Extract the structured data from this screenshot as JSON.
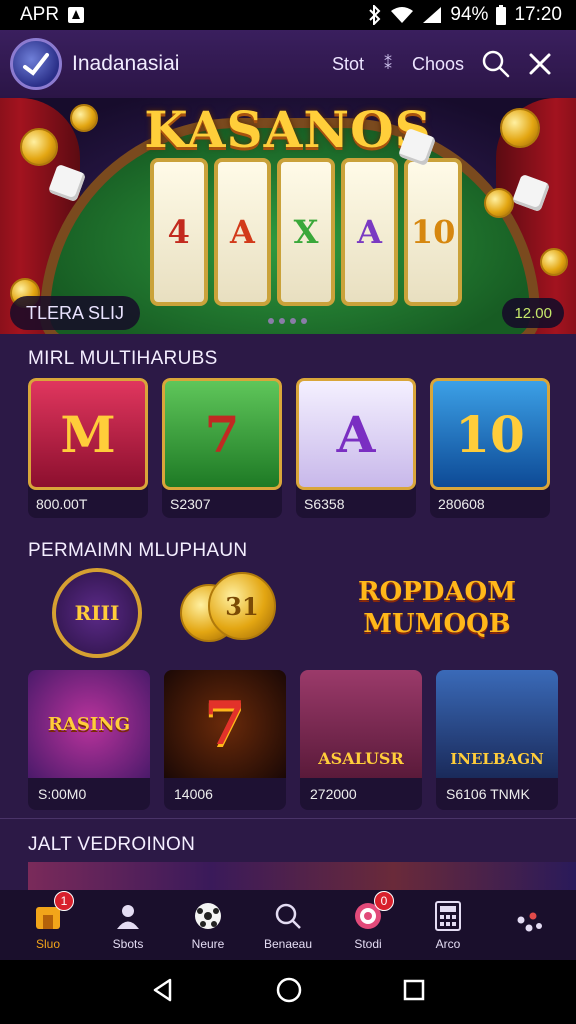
{
  "status": {
    "carrier": "APR",
    "battery_text": "94%",
    "time": "17:20"
  },
  "header": {
    "title": "Inadanasiai",
    "nav": [
      "Stot",
      "Choos"
    ],
    "dots": "⁑"
  },
  "hero": {
    "title": "KASANOS",
    "caption": "TLERA SLIJ",
    "badge": "12.00",
    "reel_symbols": [
      "4",
      "A",
      "X",
      "A",
      "10"
    ]
  },
  "sections": [
    {
      "title": "MIRL MULTIHARUBS",
      "cards": [
        {
          "symbol": "M",
          "label": "800.00T",
          "color": "#b8132a"
        },
        {
          "symbol": "7",
          "label": "S2307",
          "color": "#2f8f2f"
        },
        {
          "symbol": "A",
          "label": "S6358",
          "color": "#6b2ba8"
        },
        {
          "symbol": "10",
          "label": "280608",
          "color": "#1a63b5"
        }
      ]
    },
    {
      "title": "PERMAIMN MLUPHAUN",
      "promo_text": "ROPDAOM MUMOQB",
      "promo_coin_text": "31",
      "badge_text": "RIII",
      "cards": [
        {
          "art_text": "RASING",
          "label": "S:00M0"
        },
        {
          "art_text": "7",
          "label": "14006"
        },
        {
          "art_text": "ASALUSR",
          "label": "272000"
        },
        {
          "art_text": "INELBAGN",
          "label": "S6106 TNMK"
        }
      ]
    },
    {
      "title": "JALT VEDROINON"
    }
  ],
  "bottom_nav": [
    {
      "icon": "home-icon",
      "label": "Sluo",
      "badge": "1"
    },
    {
      "icon": "user-icon",
      "label": "Sbots"
    },
    {
      "icon": "ball-icon",
      "label": "Neure"
    },
    {
      "icon": "search-icon",
      "label": "Benaeau"
    },
    {
      "icon": "chip-icon",
      "label": "Stodi",
      "badge": "0"
    },
    {
      "icon": "calculator-icon",
      "label": "Arco"
    },
    {
      "icon": "more-icon",
      "label": ""
    }
  ]
}
